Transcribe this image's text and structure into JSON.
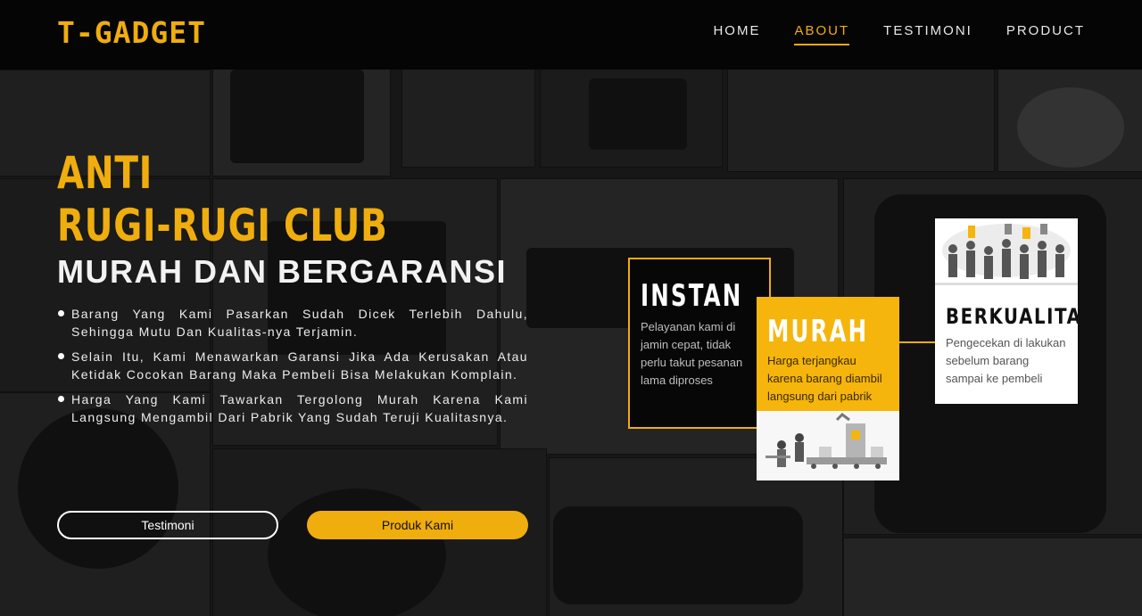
{
  "brand": {
    "logo": "T-GADGET",
    "accent": "#f0ad0e"
  },
  "nav": {
    "items": [
      {
        "label": "HOME",
        "active": false
      },
      {
        "label": "ABOUT",
        "active": true
      },
      {
        "label": "TESTIMONI",
        "active": false
      },
      {
        "label": "PRODUCT",
        "active": false
      }
    ]
  },
  "hero": {
    "title_line1": "ANTI",
    "title_line2": "RUGI-RUGI CLUB",
    "subtitle": "MURAH DAN BERGARANSI",
    "bullets": [
      "Barang Yang Kami Pasarkan Sudah Dicek Terlebih Dahulu, Sehingga Mutu Dan Kualitas-nya Terjamin.",
      "Selain Itu, Kami Menawarkan Garansi Jika Ada Kerusakan Atau Ketidak Cocokan Barang Maka Pembeli Bisa Melakukan Komplain.",
      "Harga Yang Kami Tawarkan Tergolong Murah Karena Kami Langsung Mengambil Dari Pabrik Yang Sudah Teruji Kualitasnya."
    ],
    "buttons": {
      "testimoni": "Testimoni",
      "produk": "Produk Kami"
    }
  },
  "features": {
    "instan": {
      "title": "INSTAN",
      "text": "Pelayanan kami di jamin cepat, tidak perlu takut pesanan lama diproses"
    },
    "murah": {
      "title": "MURAH",
      "text": "Harga terjangkau karena barang diambil langsung dari pabrik",
      "illustration": "factory-illustration"
    },
    "berkualitas": {
      "title": "BERKUALITAS",
      "text": "Pengecekan di lakukan sebelum barang sampai ke pembeli",
      "illustration": "team-illustration"
    }
  }
}
